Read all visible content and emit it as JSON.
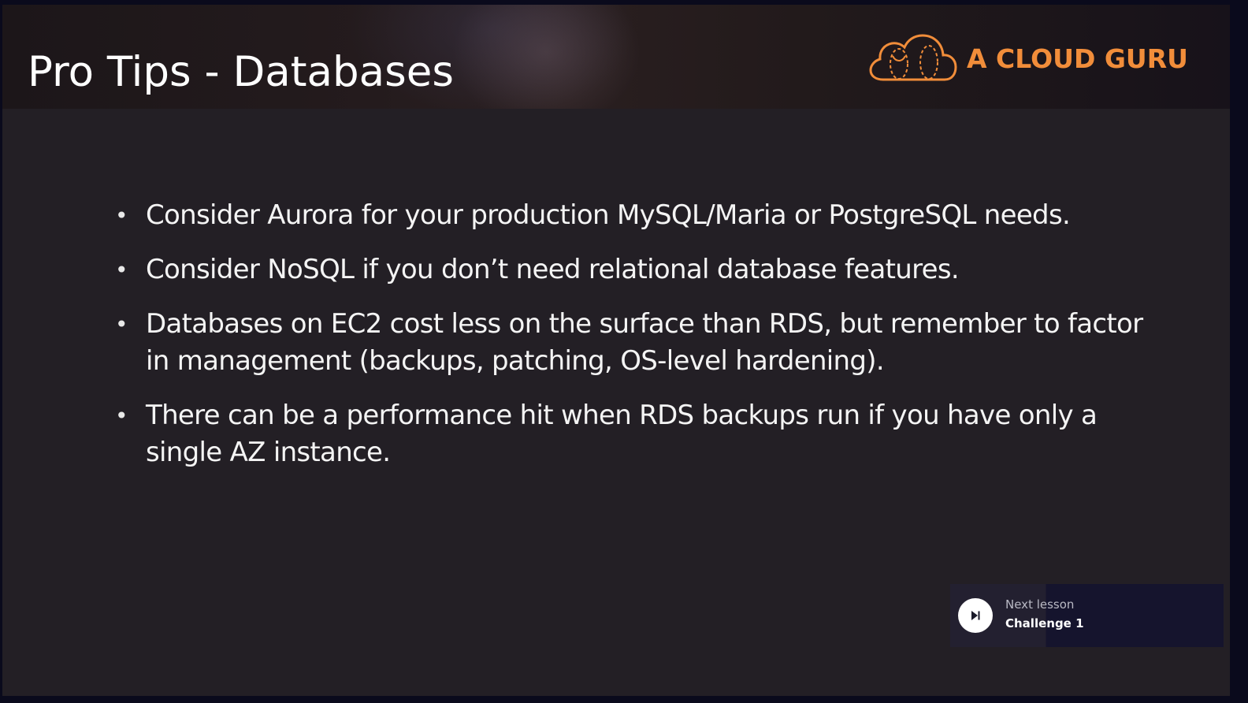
{
  "slide": {
    "title": "Pro Tips - Databases",
    "bullet_symbol": "•",
    "bullets": [
      "Consider Aurora for your production MySQL/Maria or PostgreSQL needs.",
      "Consider NoSQL if you don’t need relational database features.",
      "Databases on EC2 cost less on the surface than RDS, but remember to factor in management (backups, patching, OS-level hardening).",
      "There can be a performance hit when RDS backups run if you have only a single AZ instance."
    ]
  },
  "brand": {
    "name": "A CLOUD GURU",
    "icon": "cloud-icon",
    "color": "#f18d3a"
  },
  "next_lesson": {
    "label": "Next lesson",
    "title": "Challenge 1",
    "icon": "play-next-icon"
  }
}
